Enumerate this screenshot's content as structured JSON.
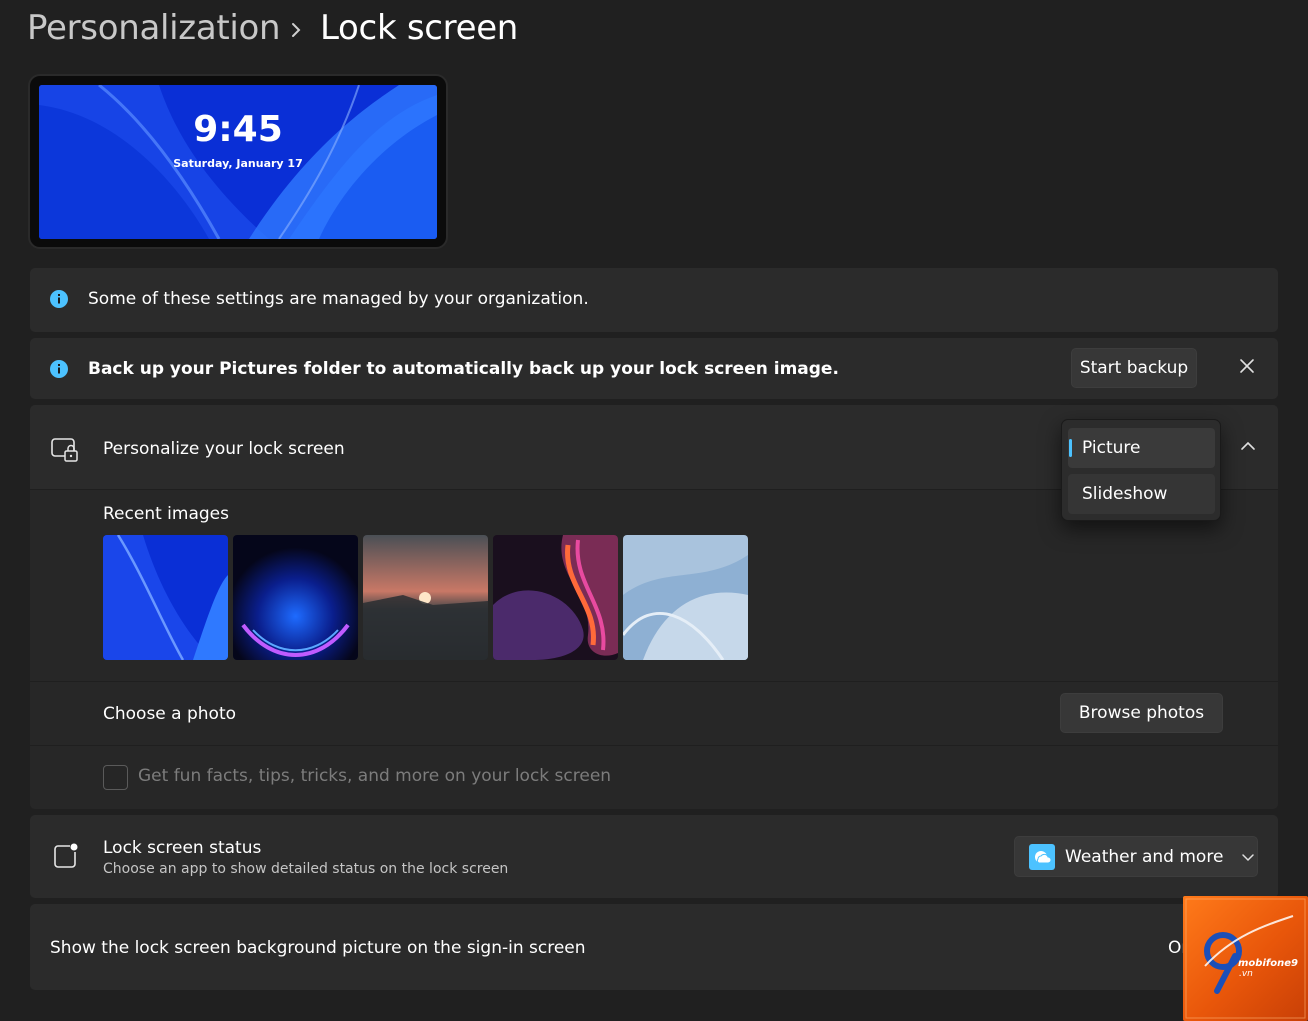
{
  "breadcrumb": {
    "parent": "Personalization",
    "current": "Lock screen"
  },
  "preview": {
    "time": "9:45",
    "date": "Saturday, January 17"
  },
  "org_notice": {
    "text": "Some of these settings are managed by your organization."
  },
  "backup_notice": {
    "text": "Back up your Pictures folder to automatically back up your lock screen image.",
    "button": "Start backup"
  },
  "personalize": {
    "title": "Personalize your lock screen",
    "options": [
      "Picture",
      "Slideshow"
    ],
    "selected": "Picture",
    "recent_images_label": "Recent images",
    "recent_images": [
      "blue-bloom",
      "dark-orb",
      "sunset-lake",
      "purple-swirl",
      "light-bloom"
    ],
    "choose_photo_label": "Choose a photo",
    "browse_button": "Browse photos",
    "fun_facts_label": "Get fun facts, tips, tricks, and more on your lock screen"
  },
  "status": {
    "title": "Lock screen status",
    "description": "Choose an app to show detailed status on the lock screen",
    "value": "Weather and more"
  },
  "signin": {
    "label": "Show the lock screen background picture on the sign-in screen",
    "toggle_text": "On"
  },
  "watermark": {
    "brand": "mobifone9",
    "domain": ".vn"
  },
  "colors": {
    "accent": "#4cc2ff",
    "background": "#202020",
    "card": "#2b2b2b"
  }
}
